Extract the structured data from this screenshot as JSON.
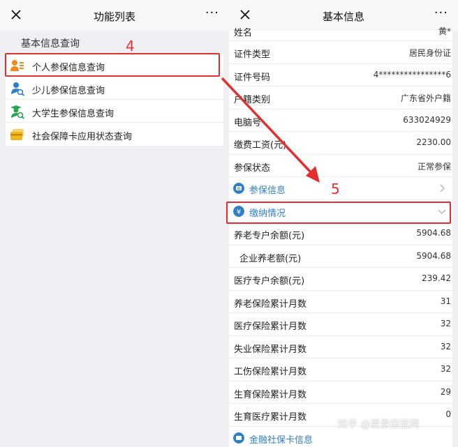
{
  "left": {
    "nav": {
      "title": "功能列表",
      "more": "···"
    },
    "section_title": "基本信息查询",
    "menu": [
      {
        "label": "个人参保信息查询",
        "icon": "person-card-icon",
        "color": "#f08a1d"
      },
      {
        "label": "少儿参保信息查询",
        "icon": "child-search-icon",
        "color": "#2e7fc6"
      },
      {
        "label": "大学生参保信息查询",
        "icon": "graduate-search-icon",
        "color": "#2aa44f"
      },
      {
        "label": "社会保障卡应用状态查询",
        "icon": "card-icon",
        "color": "#f0b81d"
      }
    ]
  },
  "right": {
    "nav": {
      "title": "基本信息",
      "more": "···"
    },
    "rows": [
      {
        "k": "姓名",
        "v": "黄*"
      },
      {
        "k": "证件类型",
        "v": "居民身份证"
      },
      {
        "k": "证件号码",
        "v": "4****************6"
      },
      {
        "k": "户籍类别",
        "v": "广东省外户籍"
      },
      {
        "k": "电脑号",
        "v": "633024929"
      },
      {
        "k": "缴费工资(元)",
        "v": "2230.00"
      },
      {
        "k": "参保状态",
        "v": "正常参保"
      }
    ],
    "sections": [
      {
        "label": "参保信息",
        "icon": "card-list-icon",
        "chevron": "chevron-right-icon"
      },
      {
        "label": "缴纳情况",
        "icon": "yuan-icon",
        "chevron": "chevron-down-icon"
      }
    ],
    "payment_rows": [
      {
        "k": "养老专户余额(元)",
        "v": "5904.68"
      },
      {
        "k": "企业养老额(元)",
        "v": "5904.68"
      },
      {
        "k": "医疗专户余额(元)",
        "v": "239.42"
      },
      {
        "k": "养老保险累计月数",
        "v": "31"
      },
      {
        "k": "医疗保险累计月数",
        "v": "32"
      },
      {
        "k": "失业保险累计月数",
        "v": "32"
      },
      {
        "k": "工伤保险累计月数",
        "v": "32"
      },
      {
        "k": "生育保险累计月数",
        "v": "29"
      },
      {
        "k": "生育医疗累计月数",
        "v": "0"
      }
    ],
    "bottom_section": {
      "label": "金融社保卡信息"
    }
  },
  "annotations": {
    "step4": "4",
    "step5": "5",
    "color": "#e23030"
  },
  "watermark": "知乎 @夏景田蓝网"
}
